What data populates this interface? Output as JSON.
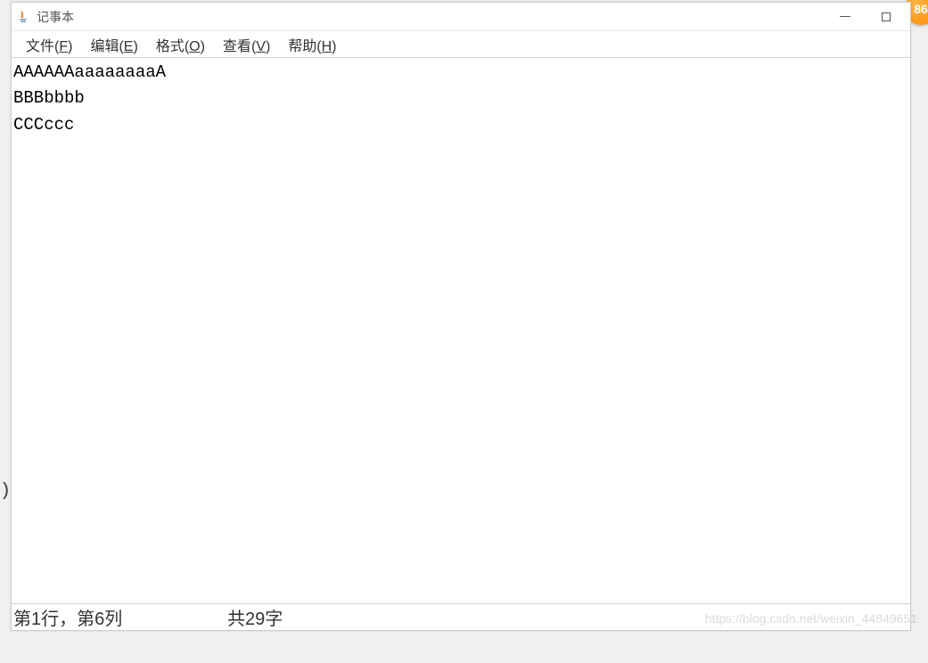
{
  "window": {
    "title": "记事本"
  },
  "menu": {
    "file": {
      "label": "文件",
      "mnemonic": "F"
    },
    "edit": {
      "label": "编辑",
      "mnemonic": "E"
    },
    "format": {
      "label": "格式",
      "mnemonic": "O"
    },
    "view": {
      "label": "查看",
      "mnemonic": "V"
    },
    "help": {
      "label": "帮助",
      "mnemonic": "H"
    }
  },
  "editor": {
    "content": "AAAAAAaaaaaaaaA\nBBBbbbb\nCCCccc"
  },
  "status": {
    "position": "第1行，第6列",
    "count": "共29字"
  },
  "watermark": "https://blog.csdn.net/weixin_44849651",
  "badge": "86",
  "stray": ")"
}
